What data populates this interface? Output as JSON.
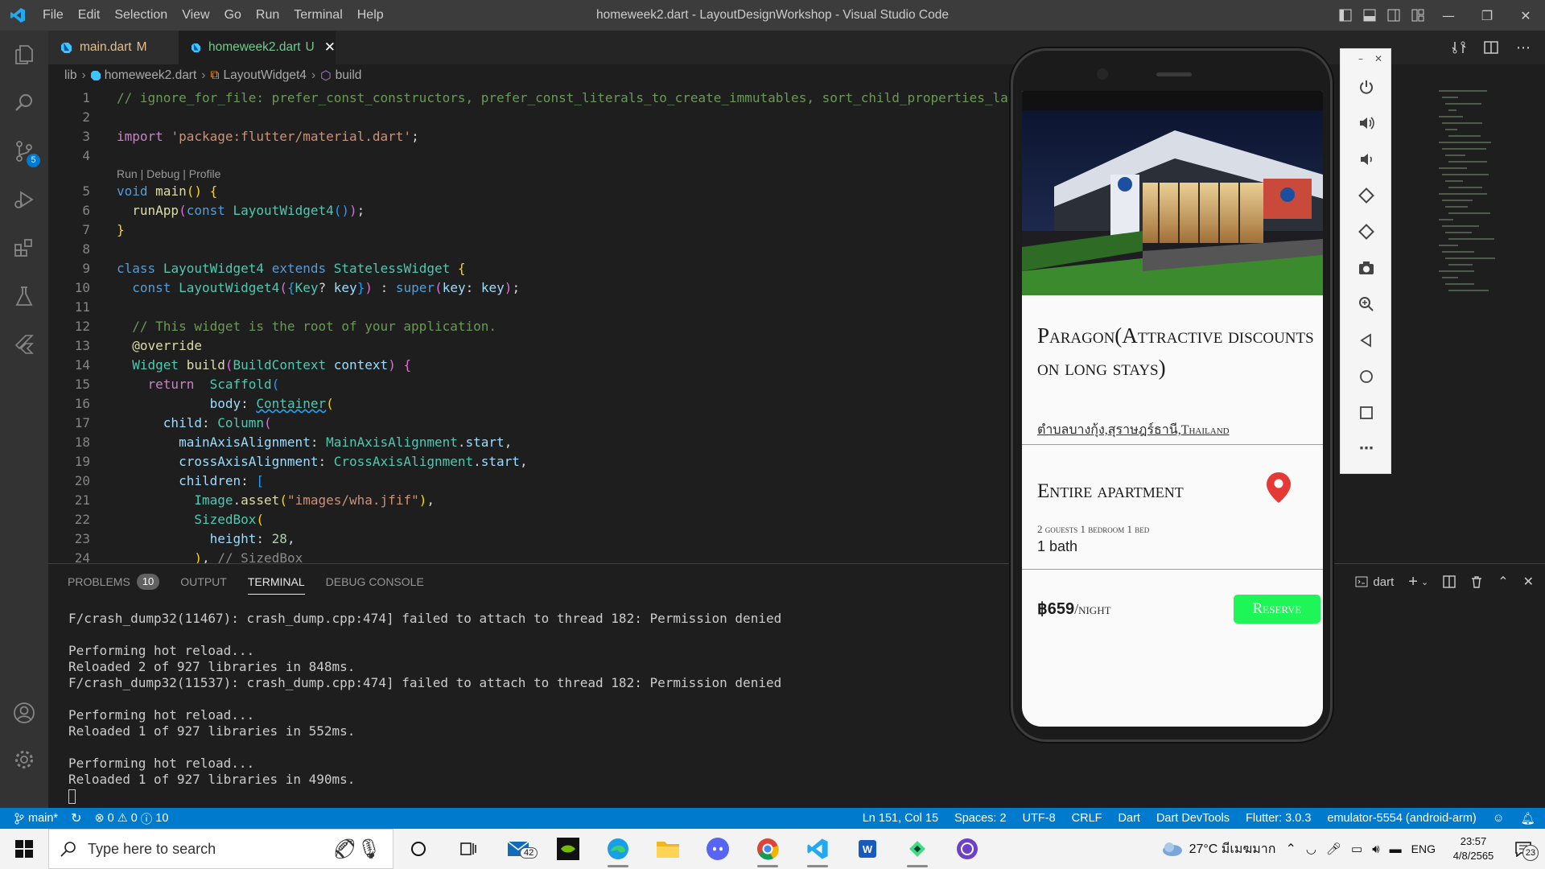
{
  "titlebar": {
    "menu": [
      "File",
      "Edit",
      "Selection",
      "View",
      "Go",
      "Run",
      "Terminal",
      "Help"
    ],
    "title": "homeweek2.dart - LayoutDesignWorkshop - Visual Studio Code"
  },
  "activitybar": {
    "items": [
      "explorer-icon",
      "search-icon",
      "source-control-icon",
      "run-debug-icon",
      "extensions-icon",
      "testing-icon",
      "flutter-icon"
    ],
    "source_control_badge": "5",
    "bottom": [
      "account-icon",
      "settings-gear-icon"
    ]
  },
  "tabs": [
    {
      "label": "main.dart",
      "status": "M"
    },
    {
      "label": "homeweek2.dart",
      "status": "U"
    }
  ],
  "breadcrumb": [
    "lib",
    "homeweek2.dart",
    "LayoutWidget4",
    "build"
  ],
  "editor": {
    "codelens": "Run | Debug | Profile",
    "line_numbers": [
      "1",
      "2",
      "3",
      "4",
      "5",
      "6",
      "7",
      "8",
      "9",
      "10",
      "11",
      "12",
      "13",
      "14",
      "15",
      "16",
      "17",
      "18",
      "19",
      "20",
      "21",
      "22",
      "23",
      "24"
    ]
  },
  "panel": {
    "tabs": [
      "PROBLEMS",
      "OUTPUT",
      "TERMINAL",
      "DEBUG CONSOLE"
    ],
    "problems_count": "10",
    "terminal_name": "dart",
    "terminal_lines": [
      "F/crash_dump32(11467): crash_dump.cpp:474] failed to attach to thread 182: Permission denied",
      "",
      "Performing hot reload...",
      "Reloaded 2 of 927 libraries in 848ms.",
      "F/crash_dump32(11537): crash_dump.cpp:474] failed to attach to thread 182: Permission denied",
      "",
      "Performing hot reload...",
      "Reloaded 1 of 927 libraries in 552ms.",
      "",
      "Performing hot reload...",
      "Reloaded 1 of 927 libraries in 490ms."
    ]
  },
  "app": {
    "title": "Paragon(Attractive discounts on long stays)",
    "location": "ตำบลบางกุ้ง,สุราษฎร์ธานี,Thailand",
    "apartment_title": "Entire apartment",
    "apartment_details": "2 gouests 1 bedroom 1 bed",
    "bath": "1 bath",
    "price": "฿659",
    "price_unit": "/night",
    "reserve_label": "Reserve",
    "colors": {
      "reserve": "#1ef556",
      "pin": "#e53935"
    }
  },
  "statusbar": {
    "branch": "main*",
    "errors": "0",
    "warnings": "0",
    "info": "10",
    "position": "Ln 151, Col 15",
    "spaces": "Spaces: 2",
    "encoding": "UTF-8",
    "eol": "CRLF",
    "language": "Dart",
    "devtools": "Dart DevTools",
    "flutter": "Flutter: 3.0.3",
    "device": "emulator-5554 (android-arm)"
  },
  "taskbar": {
    "search_placeholder": "Type here to search",
    "mail_badge": "42",
    "weather": "27°C มีเมฆมาก",
    "lang": "ENG",
    "time": "23:57",
    "date": "4/8/2565",
    "notifications": "23"
  }
}
